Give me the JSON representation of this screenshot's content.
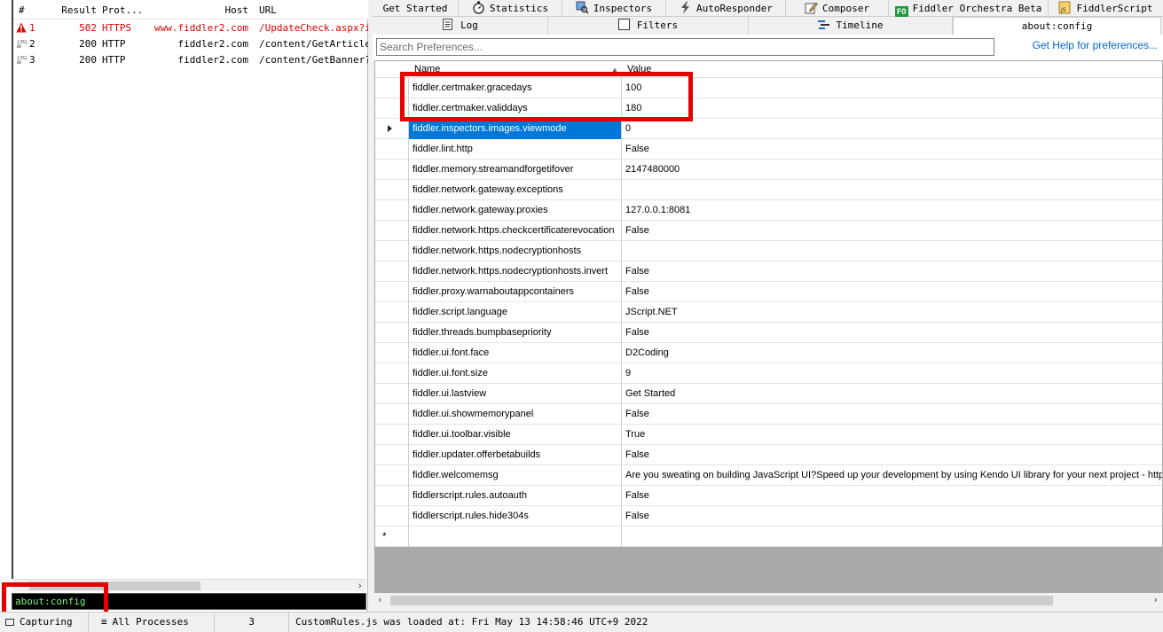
{
  "sessions": {
    "columns": {
      "num": "#",
      "result": "Result",
      "protocol": "Prot...",
      "host": "Host",
      "url": "URL"
    },
    "rows": [
      {
        "num": "1",
        "result": "502",
        "protocol": "HTTPS",
        "host": "www.fiddler2.com",
        "url": "/UpdateCheck.aspx?is",
        "icon": "warning-icon"
      },
      {
        "num": "2",
        "result": "200",
        "protocol": "HTTP",
        "host": "fiddler2.com",
        "url": "/content/GetArticles",
        "icon": "json-icon"
      },
      {
        "num": "3",
        "result": "200",
        "protocol": "HTTP",
        "host": "fiddler2.com",
        "url": "/content/GetBanner?c",
        "icon": "json-icon"
      }
    ]
  },
  "quickexec": {
    "value": "about:config"
  },
  "tabs_top": [
    {
      "label": "Get Started",
      "icon": ""
    },
    {
      "label": "Statistics",
      "icon": "stopwatch-icon"
    },
    {
      "label": "Inspectors",
      "icon": "inspectors-icon"
    },
    {
      "label": "AutoResponder",
      "icon": "lightning-icon"
    },
    {
      "label": "Composer",
      "icon": "pencil-icon"
    },
    {
      "label": "Fiddler Orchestra Beta",
      "icon": "fo-icon",
      "icon_text": "FO"
    },
    {
      "label": "FiddlerScript",
      "icon": "script-icon"
    }
  ],
  "tabs_bottom": [
    {
      "label": "Log",
      "icon": "log-icon"
    },
    {
      "label": "Filters",
      "icon": "checkbox-icon"
    },
    {
      "label": "Timeline",
      "icon": "timeline-icon"
    },
    {
      "label": "about:config",
      "icon": ""
    }
  ],
  "search": {
    "placeholder": "Search Preferences...",
    "help_link": "Get Help for preferences..."
  },
  "grid": {
    "header": {
      "name": "Name",
      "value": "Value"
    },
    "rows": [
      {
        "name": "fiddler.certmaker.gracedays",
        "value": "100"
      },
      {
        "name": "fiddler.certmaker.validdays",
        "value": "180"
      },
      {
        "name": "fiddler.inspectors.images.viewmode",
        "value": "0"
      },
      {
        "name": "fiddler.lint.http",
        "value": "False"
      },
      {
        "name": "fiddler.memory.streamandforgetifover",
        "value": "2147480000"
      },
      {
        "name": "fiddler.network.gateway.exceptions",
        "value": ""
      },
      {
        "name": "fiddler.network.gateway.proxies",
        "value": "127.0.0.1:8081"
      },
      {
        "name": "fiddler.network.https.checkcertificaterevocation",
        "value": "False"
      },
      {
        "name": "fiddler.network.https.nodecryptionhosts",
        "value": ""
      },
      {
        "name": "fiddler.network.https.nodecryptionhosts.invert",
        "value": "False"
      },
      {
        "name": "fiddler.proxy.warnaboutappcontainers",
        "value": "False"
      },
      {
        "name": "fiddler.script.language",
        "value": "JScript.NET"
      },
      {
        "name": "fiddler.threads.bumpbasepriority",
        "value": "False"
      },
      {
        "name": "fiddler.ui.font.face",
        "value": "D2Coding"
      },
      {
        "name": "fiddler.ui.font.size",
        "value": "9"
      },
      {
        "name": "fiddler.ui.lastview",
        "value": "Get Started"
      },
      {
        "name": "fiddler.ui.showmemorypanel",
        "value": "False"
      },
      {
        "name": "fiddler.ui.toolbar.visible",
        "value": "True"
      },
      {
        "name": "fiddler.updater.offerbetabuilds",
        "value": "False"
      },
      {
        "name": "fiddler.welcomemsg",
        "value": "Are you sweating on building JavaScript UI?Speed up your development by using Kendo UI library for your next project - http"
      },
      {
        "name": "fiddlerscript.rules.autoauth",
        "value": "False"
      },
      {
        "name": "fiddlerscript.rules.hide304s",
        "value": "False"
      }
    ],
    "new_row_marker": "*"
  },
  "statusbar": {
    "capturing": "Capturing",
    "process_filter": "All Processes",
    "session_count": "3",
    "message": "CustomRules.js was loaded at: Fri May 13 14:58:46 UTC+9 2022"
  },
  "colors": {
    "highlight_box": "#e60000",
    "selection": "#0078d7",
    "error_text": "#e00000"
  }
}
